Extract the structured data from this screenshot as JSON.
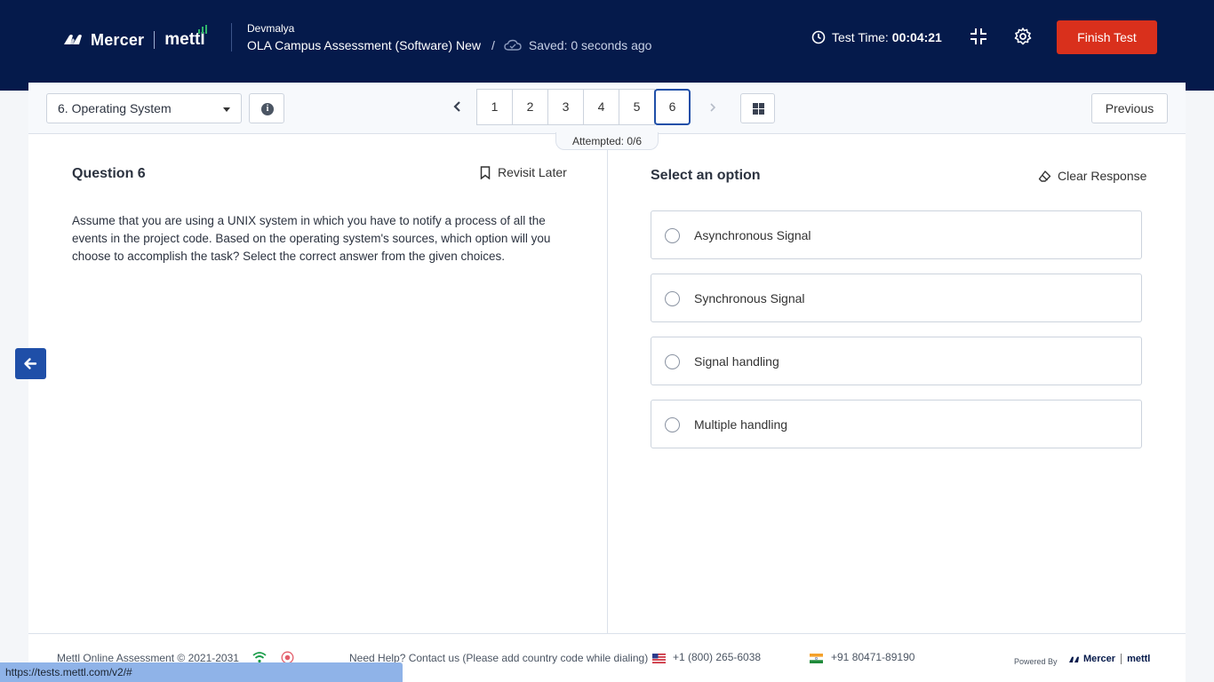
{
  "header": {
    "brand_mercer": "Mercer",
    "brand_mettl": "mettl",
    "user_name": "Devmalya",
    "test_name": "OLA Campus Assessment (Software) New",
    "separator": "/",
    "saved_status": "Saved: 0 seconds ago",
    "timer_label": "Test Time:",
    "timer_value": "00:04:21",
    "finish_label": "Finish Test"
  },
  "toolbar": {
    "section_selected": "6. Operating System",
    "info_glyph": "i",
    "pages": [
      "1",
      "2",
      "3",
      "4",
      "5",
      "6"
    ],
    "active_page": "6",
    "previous_label": "Previous",
    "attempted": "Attempted: 0/6"
  },
  "question": {
    "title": "Question 6",
    "revisit_label": "Revisit Later",
    "text": "Assume that you are using a UNIX system in which you have to notify a process of all the events in the project code. Based on the operating system's sources, which option will you choose to accomplish the task? Select the correct answer from the given choices."
  },
  "answers": {
    "title": "Select an option",
    "clear_label": "Clear Response",
    "options": [
      "Asynchronous Signal",
      "Synchronous Signal",
      "Signal handling",
      "Multiple handling"
    ]
  },
  "footer": {
    "copyright": "Mettl Online Assessment © 2021-2031",
    "help": "Need Help? Contact us (Please add country code while dialing)",
    "phone_us": "+1 (800) 265-6038",
    "phone_in": "+91 80471-89190",
    "powered_by": "Powered By",
    "mini_mercer": "Mercer",
    "mini_mettl": "mettl"
  },
  "status_bar": {
    "url": "https://tests.mettl.com/v2/#"
  },
  "colors": {
    "header_bg": "#051a4b",
    "finish_btn": "#d9301c",
    "accent_blue": "#1f4fa8"
  },
  "icons": [
    "mercer-logo-icon",
    "clock-icon",
    "exit-fullscreen-icon",
    "gear-icon",
    "cloud-icon",
    "info-icon",
    "chevron-left-icon",
    "chevron-right-icon",
    "grid-icon",
    "bookmark-icon",
    "eraser-icon",
    "arrow-left-icon",
    "wifi-icon",
    "record-icon",
    "us-flag-icon",
    "india-flag-icon"
  ]
}
